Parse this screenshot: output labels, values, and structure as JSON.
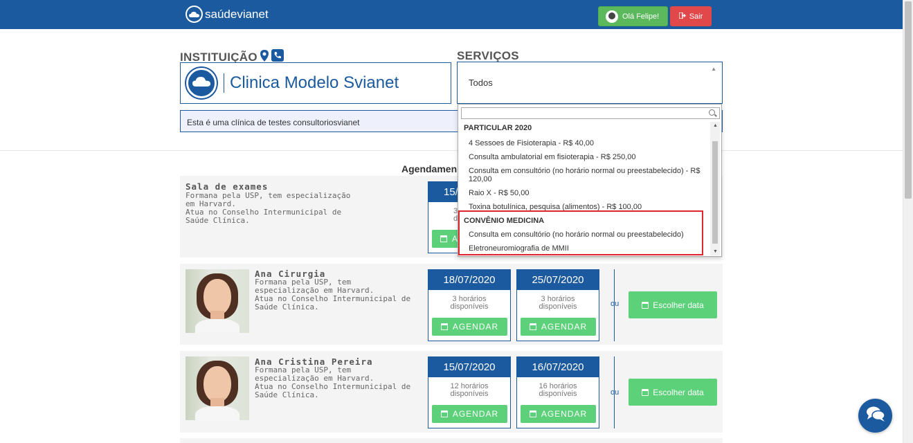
{
  "header": {
    "logo_text": "saúdevianet",
    "greeting": "Olá Felipe!",
    "logout": "Sair"
  },
  "institution": {
    "label": "INSTITUIÇÃO",
    "name": "Clinica Modelo Svianet",
    "description": "Esta é uma clínica de testes consultoriosvianet"
  },
  "services": {
    "label": "SERVIÇOS",
    "selected": "Todos",
    "search_placeholder": "",
    "groups": [
      {
        "name": "PARTICULAR 2020",
        "items": [
          "4 Sessoes de Fisioterapia - R$ 40,00",
          "Consulta ambulatorial em fisioterapia - R$ 250,00",
          "Consulta em consultório (no horário normal ou preestabelecido) - R$ 120,00",
          "Raio X - R$ 50,00",
          "Toxina botulínica, pesquisa (alimentos) - R$ 100,00"
        ]
      },
      {
        "name": "CONVÊNIO MEDICINA",
        "items": [
          "Consulta em consultório (no horário normal ou preestabelecido)",
          "Eletroneuromiografia de MMII"
        ]
      }
    ]
  },
  "schedule_title": "Agendamen",
  "cards": [
    {
      "name": "Sala de exames",
      "desc_line1": "Formana pela USP, tem especialização em Harvard.",
      "desc_line2": "Atua no Conselho Intermunicipal de Saúde Clínica.",
      "date1": "15/",
      "avail1_a": "3",
      "avail1_b": "di",
      "agendar": "AG"
    },
    {
      "name": "Ana Cirurgia",
      "desc_line1": "Formana pela USP, tem especialização em Harvard.",
      "desc_line2": "Atua no Conselho Intermunicipal de Saúde Clínica.",
      "date1": "18/07/2020",
      "avail1_a": "3 horários",
      "avail1_b": "disponíveis",
      "date2": "25/07/2020",
      "avail2_a": "3 horários",
      "avail2_b": "disponíveis",
      "agendar": "AGENDAR",
      "or": "ou",
      "choose": "Escolher data"
    },
    {
      "name": "Ana Cristina Pereira",
      "desc_line1": "Formana pela USP, tem especialização em Harvard.",
      "desc_line2": "Atua no Conselho Intermunicipal de Saúde Clínica.",
      "date1": "15/07/2020",
      "avail1_a": "12 horários",
      "avail1_b": "disponíveis",
      "date2": "16/07/2020",
      "avail2_a": "16 horários",
      "avail2_b": "disponíveis",
      "agendar": "AGENDAR",
      "or": "ou",
      "choose": "Escolher data"
    }
  ],
  "colors": {
    "primary": "#1b5a9e",
    "success": "#5cd17a",
    "danger": "#e0484a",
    "highlight": "#e0262d"
  }
}
